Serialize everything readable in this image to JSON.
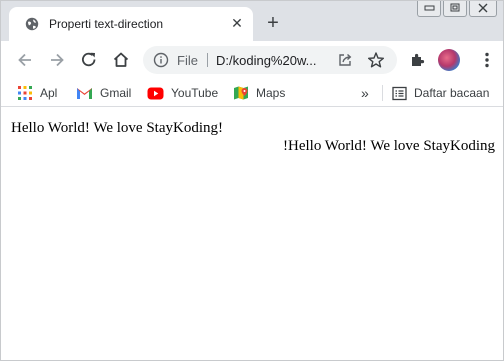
{
  "tab": {
    "title": "Properti text-direction",
    "favicon": "globe-icon"
  },
  "toolbar": {
    "omnibox": {
      "scheme": "File",
      "url": "D:/koding%20w..."
    },
    "icons": [
      "back-arrow-icon",
      "forward-arrow-icon",
      "reload-icon",
      "home-icon",
      "extensions-puzzle-icon",
      "kebab-menu-icon"
    ]
  },
  "bookmarks": {
    "items": [
      {
        "label": "Apl",
        "icon": "apps-grid-icon"
      },
      {
        "label": "Gmail",
        "icon": "gmail-icon"
      },
      {
        "label": "YouTube",
        "icon": "youtube-icon"
      },
      {
        "label": "Maps",
        "icon": "maps-icon"
      }
    ],
    "overflow": "»",
    "reading_list": "Daftar bacaan"
  },
  "content": {
    "line_ltr": "Hello World! We love StayKoding!",
    "line_rtl": "!Hello World! We love StayKoding"
  },
  "colors": {
    "tabstrip": "#dee1e6",
    "omnibox": "#f1f3f4",
    "youtube": "#ff0000"
  }
}
